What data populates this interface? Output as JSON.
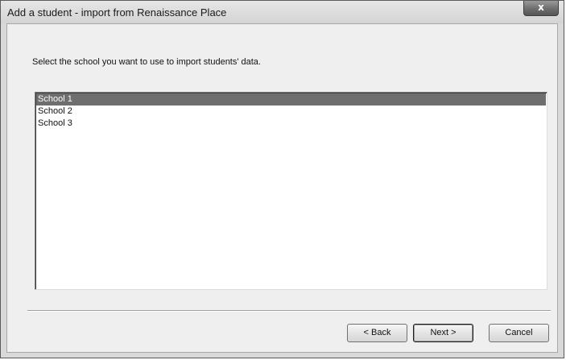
{
  "window": {
    "title": "Add a student - import from Renaissance Place",
    "close_glyph": "x"
  },
  "instruction": "Select the school you want to use to import students' data.",
  "schools": [
    {
      "label": "School 1",
      "selected": true
    },
    {
      "label": "School 2",
      "selected": false
    },
    {
      "label": "School 3",
      "selected": false
    }
  ],
  "buttons": {
    "back": "< Back",
    "next": "Next >",
    "cancel": "Cancel"
  },
  "colors": {
    "selection": "#6e6e6e",
    "dialog_background": "#efefef"
  }
}
